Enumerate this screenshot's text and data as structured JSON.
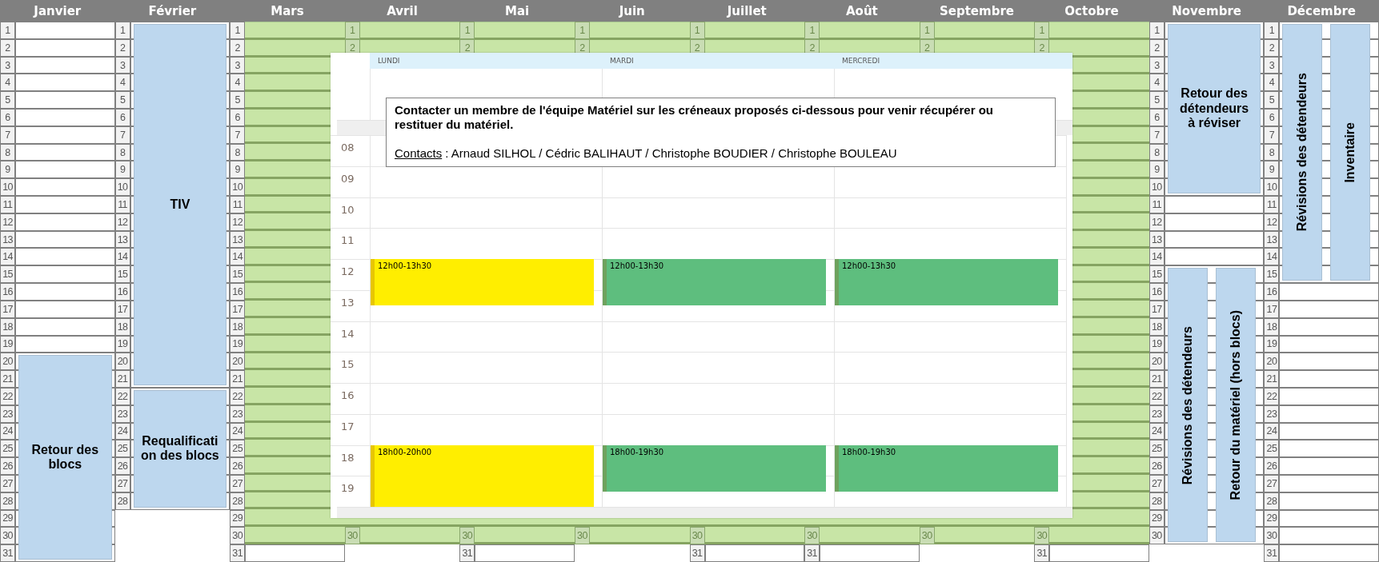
{
  "months": [
    {
      "name": "Janvier",
      "groups": [
        {
          "kind": "plain",
          "days": [
            "1",
            "2",
            "3",
            "4",
            "5",
            "6",
            "7",
            "8",
            "9",
            "10",
            "11",
            "12",
            "13",
            "14",
            "15",
            "16",
            "17",
            "18",
            "19"
          ]
        },
        {
          "kind": "block",
          "days": [
            "20",
            "21",
            "22",
            "23",
            "24",
            "25",
            "26",
            "27",
            "28",
            "29",
            "30",
            "31"
          ],
          "entries": [
            {
              "label": "Retour des blocs",
              "kind": "horizontal"
            }
          ]
        }
      ]
    },
    {
      "name": "Février",
      "groups": [
        {
          "kind": "block",
          "days": [
            "1",
            "2",
            "3",
            "4",
            "5",
            "6",
            "7",
            "8",
            "9",
            "10",
            "11",
            "12",
            "13",
            "14",
            "15",
            "16",
            "17",
            "18",
            "19",
            "20",
            "21"
          ],
          "entries": [
            {
              "label": "TIV",
              "kind": "horizontal"
            }
          ]
        },
        {
          "kind": "block",
          "days": [
            "22",
            "23",
            "24",
            "25",
            "26",
            "27",
            "28"
          ],
          "entries": [
            {
              "label": "Requalification des blocs",
              "kind": "horizontal"
            }
          ]
        }
      ]
    },
    {
      "name": "Mars",
      "groups": [
        {
          "kind": "highlight",
          "days": [
            "1",
            "2",
            "3",
            "4",
            "5",
            "6",
            "7",
            "8",
            "9",
            "10",
            "11",
            "12",
            "13",
            "14",
            "15",
            "16",
            "17",
            "18",
            "19",
            "20",
            "21",
            "22",
            "23",
            "24",
            "25",
            "26",
            "27",
            "28",
            "29",
            "30"
          ]
        },
        {
          "kind": "plain",
          "days": [
            "31"
          ]
        }
      ]
    },
    {
      "name": "Avril",
      "groups": [
        {
          "kind": "highlight",
          "days": [
            "1",
            "2",
            "30"
          ]
        }
      ]
    },
    {
      "name": "Mai",
      "groups": [
        {
          "kind": "highlight",
          "days": [
            "1",
            "2",
            "30"
          ]
        },
        {
          "kind": "plain",
          "days": [
            "31"
          ]
        }
      ]
    },
    {
      "name": "Juin",
      "groups": [
        {
          "kind": "highlight",
          "days": [
            "1",
            "2",
            "30"
          ]
        }
      ]
    },
    {
      "name": "Juillet",
      "groups": [
        {
          "kind": "highlight",
          "days": [
            "1",
            "2",
            "30"
          ]
        },
        {
          "kind": "plain",
          "days": [
            "31"
          ]
        }
      ]
    },
    {
      "name": "Août",
      "groups": [
        {
          "kind": "highlight",
          "days": [
            "1",
            "2",
            "30"
          ]
        },
        {
          "kind": "plain",
          "days": [
            "31"
          ]
        }
      ]
    },
    {
      "name": "Septembre",
      "groups": [
        {
          "kind": "highlight",
          "days": [
            "1",
            "2",
            "30"
          ]
        }
      ]
    },
    {
      "name": "Octobre",
      "groups": [
        {
          "kind": "highlight",
          "days": [
            "1",
            "2",
            "30"
          ]
        },
        {
          "kind": "plain",
          "days": [
            "31"
          ]
        }
      ]
    },
    {
      "name": "Novembre",
      "groups": [
        {
          "kind": "block",
          "days": [
            "1",
            "2",
            "3",
            "4",
            "5",
            "6",
            "7",
            "8",
            "9",
            "10"
          ],
          "entries": [
            {
              "label": "Retour des détendeurs à réviser",
              "kind": "horizontal"
            }
          ]
        },
        {
          "kind": "plain",
          "days": [
            "11",
            "12",
            "13",
            "14"
          ]
        },
        {
          "kind": "block",
          "days": [
            "15",
            "16",
            "17",
            "18",
            "19",
            "20",
            "21",
            "22",
            "23",
            "24",
            "25",
            "26",
            "27",
            "28",
            "29",
            "30"
          ],
          "entries": [
            {
              "label": "Révisions des détendeurs",
              "kind": "vertical"
            },
            {
              "label": "Retour du matériel (hors blocs)",
              "kind": "vertical"
            }
          ]
        }
      ]
    },
    {
      "name": "Décembre",
      "groups": [
        {
          "kind": "block",
          "days": [
            "1",
            "2",
            "3",
            "4",
            "5",
            "6",
            "7",
            "8",
            "9",
            "10",
            "11",
            "12",
            "13",
            "14",
            "15"
          ],
          "entries": [
            {
              "label": "Révisions des détendeurs",
              "kind": "vertical"
            },
            {
              "label": "Inventaire",
              "kind": "vertical"
            }
          ]
        },
        {
          "kind": "plain",
          "days": [
            "16",
            "17",
            "18",
            "19",
            "20",
            "21",
            "22",
            "23",
            "24",
            "25",
            "26",
            "27",
            "28",
            "29",
            "30",
            "31"
          ]
        }
      ]
    }
  ],
  "planner": {
    "days": [
      {
        "label": "LUNDI",
        "events": [
          {
            "time": "12h00-13h30",
            "color": "#ffee00"
          },
          {
            "time": "18h00-20h00",
            "color": "#ffee00"
          }
        ]
      },
      {
        "label": "MARDI",
        "events": [
          {
            "time": "12h00-13h30",
            "color": "#5ebe7e"
          },
          {
            "time": "18h00-19h30",
            "color": "#5ebe7e"
          }
        ]
      },
      {
        "label": "MERCREDI",
        "events": [
          {
            "time": "12h00-13h30",
            "color": "#5ebe7e"
          },
          {
            "time": "18h00-19h30",
            "color": "#5ebe7e"
          }
        ]
      }
    ],
    "hours": [
      {
        "label": "08"
      },
      {
        "label": "09"
      },
      {
        "label": "10"
      },
      {
        "label": "11"
      },
      {
        "label": "12"
      },
      {
        "label": "13"
      },
      {
        "label": "14"
      },
      {
        "label": "15"
      },
      {
        "label": "16"
      },
      {
        "label": "17"
      },
      {
        "label": "18"
      },
      {
        "label": "19"
      }
    ],
    "notice": {
      "message": "Contacter un membre de l'équipe Matériel sur les créneaux proposés ci-dessous pour venir récupérer ou restituer du matériel.",
      "contacts_label": "Contacts",
      "contacts": ": Arnaud SILHOL / Cédric BALIHAUT / Christophe BOUDIER / Christophe BOULEAU"
    }
  }
}
